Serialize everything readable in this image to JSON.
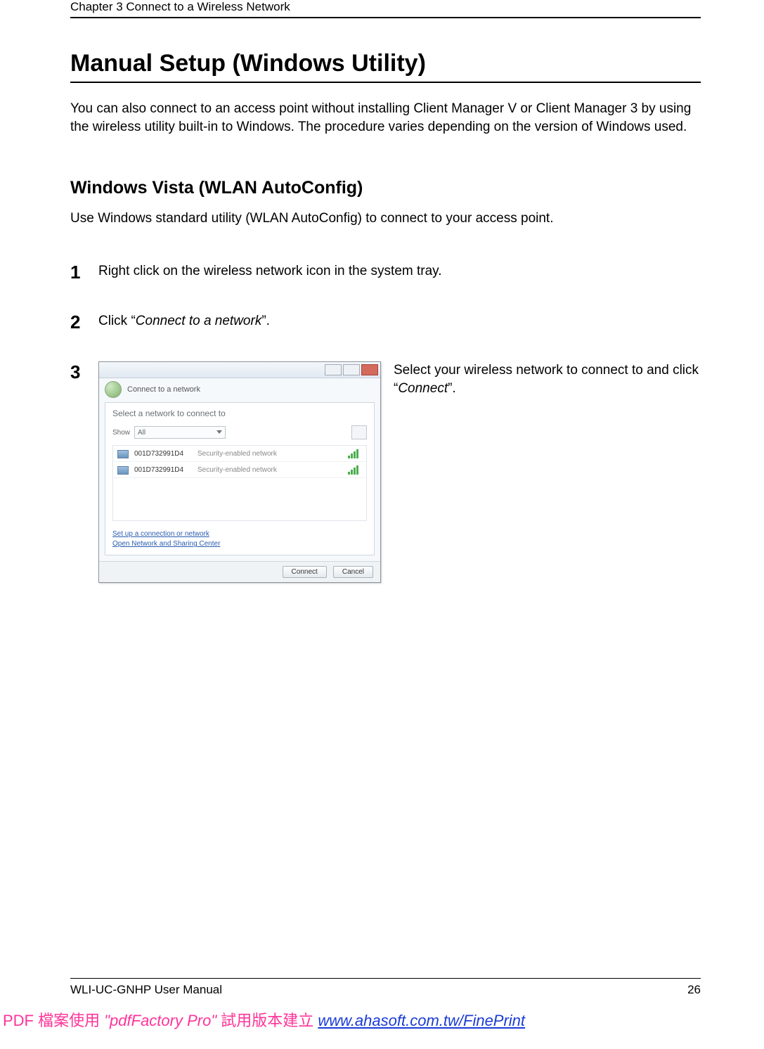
{
  "chapter_header": "Chapter 3  Connect to a Wireless Network",
  "section_title": "Manual Setup (Windows Utility)",
  "intro_text": "You can also connect to an access point without installing Client Manager V or Client Manager 3 by using the wireless utility built-in to Windows.  The procedure varies depending on the version of Windows used.",
  "subsection_title": "Windows Vista (WLAN AutoConfig)",
  "subsection_intro": "Use Windows standard utility (WLAN AutoConfig) to connect to your access point.",
  "steps": {
    "s1": {
      "num": "1",
      "text": "Right click on the wireless network icon in the system tray."
    },
    "s2": {
      "num": "2",
      "prefix": "Click ",
      "quote_open": "“",
      "italic": "Connect to a network",
      "quote_close": "”."
    },
    "s3": {
      "num": "3",
      "text_prefix": "Select your wireless network to connect to and click ",
      "quote_open": "“",
      "italic": "Connect",
      "quote_close": "”."
    }
  },
  "dialog": {
    "title": "Connect to a network",
    "subtitle": "Select a network to connect to",
    "show_label": "Show",
    "show_value": "All",
    "networks": [
      {
        "name": "001D732991D4",
        "sec": "Security-enabled network"
      },
      {
        "name": "001D732991D4",
        "sec": "Security-enabled network"
      }
    ],
    "link1": "Set up a connection or network",
    "link2": "Open Network and Sharing Center",
    "btn_connect": "Connect",
    "btn_cancel": "Cancel"
  },
  "footer": {
    "left": "WLI-UC-GNHP User Manual",
    "right": "26"
  },
  "watermark": {
    "t1": "PDF 檔案使用 ",
    "prod": "\"pdfFactory Pro\"",
    "t2": " 試用版本建立 ",
    "link": "www.ahasoft.com.tw/FinePrint"
  }
}
